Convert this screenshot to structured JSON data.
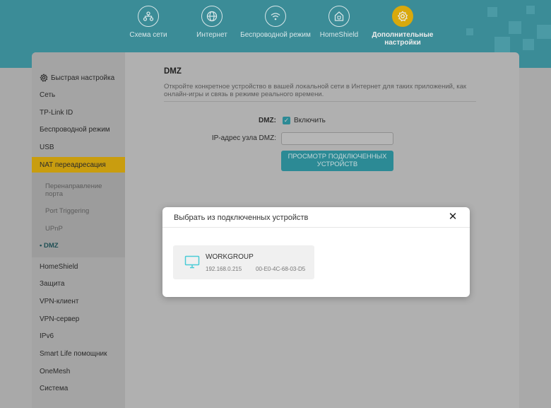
{
  "header": {
    "nav": [
      {
        "label": "Схема сети",
        "icon": "network-map-icon"
      },
      {
        "label": "Интернет",
        "icon": "globe-icon"
      },
      {
        "label": "Беспроводной режим",
        "icon": "wifi-icon"
      },
      {
        "label": "HomeShield",
        "icon": "home-shield-icon"
      },
      {
        "label": "Дополнительные настройки",
        "icon": "gear-icon",
        "active": true
      }
    ]
  },
  "sidebar": {
    "quick_setup": "Быстрая настройка",
    "items": [
      "Сеть",
      "TP-Link ID",
      "Беспроводной режим",
      "USB"
    ],
    "active": "NAT переадресация",
    "sub_items": [
      "Перенаправление порта",
      "Port Triggering",
      "UPnP",
      "DMZ"
    ],
    "active_sub": "DMZ",
    "items_after": [
      "HomeShield",
      "Защита",
      "VPN-клиент",
      "VPN-сервер",
      "IPv6",
      "Smart Life помощник",
      "OneMesh",
      "Система"
    ]
  },
  "content": {
    "title": "DMZ",
    "description": "Откройте конкретное устройство в вашей локальной сети в Интернет для таких приложений, как онлайн-игры и связь в режиме реального времени.",
    "dmz_label": "DMZ:",
    "enable_label": "Включить",
    "enabled": true,
    "ip_label": "IP-адрес узла DMZ:",
    "ip_value": "",
    "view_button": "ПРОСМОТР ПОДКЛЮЧЕННЫХ УСТРОЙСТВ"
  },
  "modal": {
    "title": "Выбрать из подключенных устройств",
    "devices": [
      {
        "name": "WORKGROUP",
        "ip": "192.168.0.215",
        "mac": "00-E0-4C-68-03-D5"
      }
    ]
  },
  "colors": {
    "accent": "#4acbd6",
    "active": "#ffc500",
    "header": "#4aa7b4"
  }
}
